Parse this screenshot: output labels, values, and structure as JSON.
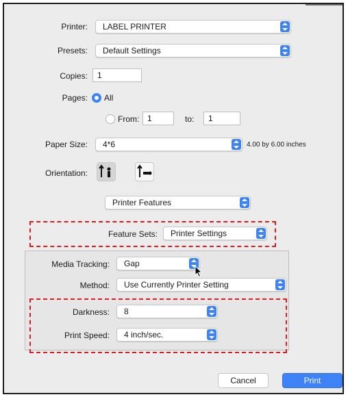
{
  "printer": {
    "label": "Printer:",
    "value": "LABEL PRINTER"
  },
  "presets": {
    "label": "Presets:",
    "value": "Default Settings"
  },
  "copies": {
    "label": "Copies:",
    "value": "1"
  },
  "pages": {
    "label": "Pages:",
    "all_label": "All",
    "from_label": "From:",
    "from_value": "1",
    "to_label": "to:",
    "to_value": "1",
    "selected": "All"
  },
  "paper_size": {
    "label": "Paper Size:",
    "value": "4*6",
    "dimensions": "4.00 by 6.00 inches"
  },
  "orientation": {
    "label": "Orientation:",
    "selected": "portrait"
  },
  "section": {
    "value": "Printer Features"
  },
  "feature_sets": {
    "label": "Feature Sets:",
    "value": "Printer Settings"
  },
  "media_tracking": {
    "label": "Media Tracking:",
    "value": "Gap"
  },
  "method": {
    "label": "Method:",
    "value": "Use Currently Printer Setting"
  },
  "darkness": {
    "label": "Darkness:",
    "value": "8"
  },
  "print_speed": {
    "label": "Print Speed:",
    "value": "4 inch/sec."
  },
  "buttons": {
    "cancel": "Cancel",
    "print": "Print"
  },
  "colors": {
    "accent": "#3d82f6",
    "highlight_dash": "#e01b1b"
  }
}
